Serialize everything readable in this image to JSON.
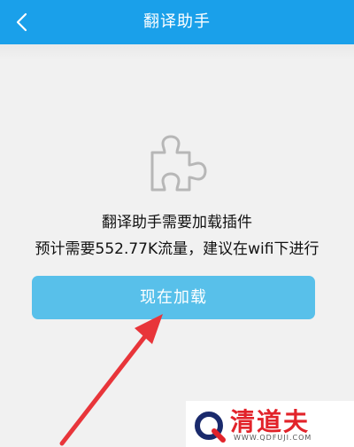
{
  "header": {
    "title": "翻译助手"
  },
  "message": {
    "line1": "翻译助手需要加载插件",
    "line2": "预计需要552.77K流量，建议在wifi下进行"
  },
  "action": {
    "load_label": "现在加载"
  },
  "watermark": {
    "brand": "清道夫",
    "url": "WWW.QDFUJI.COM"
  },
  "colors": {
    "header_bg": "#1aa0ea",
    "button_bg": "#58c0ea",
    "arrow": "#e8353a",
    "brand_red": "#e2232a"
  },
  "icons": {
    "back": "chevron-left-icon",
    "plugin": "puzzle-piece-icon",
    "annotation": "arrow-icon"
  }
}
